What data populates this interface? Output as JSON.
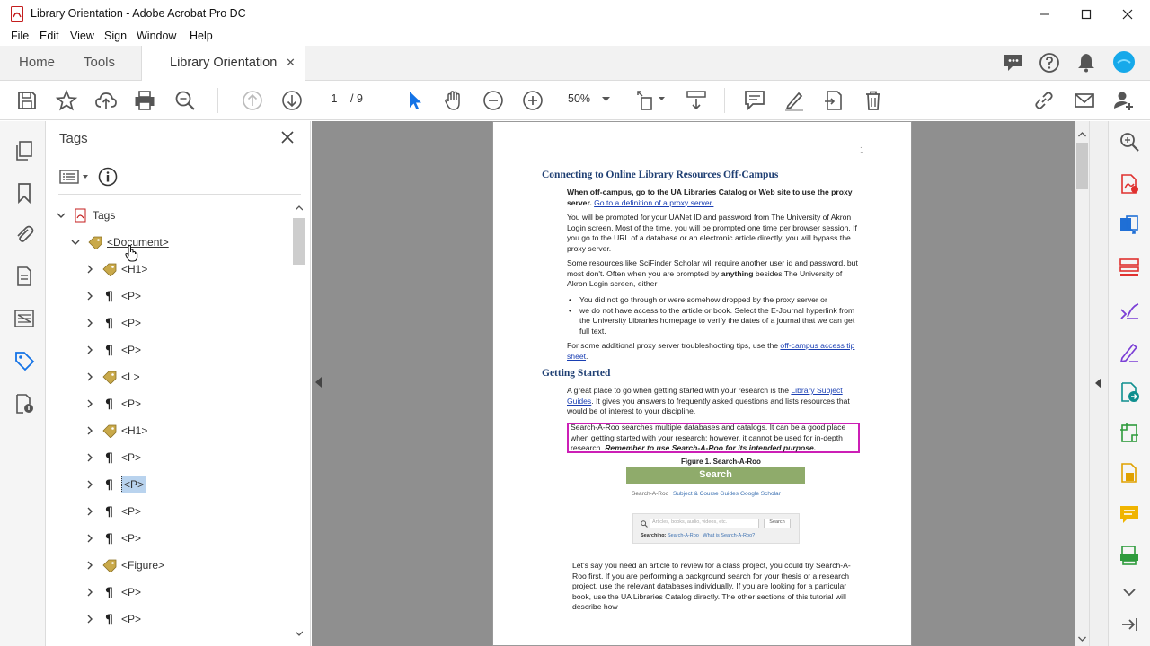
{
  "window": {
    "title": "Library Orientation - Adobe Acrobat Pro DC",
    "app_icon": "acrobat-icon",
    "controls": [
      "minimize-icon",
      "maximize-icon",
      "close-icon"
    ]
  },
  "menu": [
    "File",
    "Edit",
    "View",
    "Sign",
    "Window",
    "Help"
  ],
  "tabs": {
    "home": "Home",
    "tools": "Tools",
    "document": "Library Orientation",
    "close_glyph": "✕"
  },
  "toolbar": {
    "current_page": "1",
    "total_pages": "/ 9",
    "zoom": "50%"
  },
  "tags_panel": {
    "title": "Tags",
    "tree": [
      {
        "label": "Tags",
        "level": 0,
        "icon": "pdf-icon",
        "expanded": true
      },
      {
        "label": "<Document>",
        "level": 1,
        "icon": "tag-icon",
        "expanded": true
      },
      {
        "label": "<H1>",
        "level": 2,
        "icon": "tag-icon"
      },
      {
        "label": "<P>",
        "level": 2,
        "icon": "paragraph-icon"
      },
      {
        "label": "<P>",
        "level": 2,
        "icon": "paragraph-icon"
      },
      {
        "label": "<P>",
        "level": 2,
        "icon": "paragraph-icon"
      },
      {
        "label": "<L>",
        "level": 2,
        "icon": "tag-icon"
      },
      {
        "label": "<P>",
        "level": 2,
        "icon": "paragraph-icon"
      },
      {
        "label": "<H1>",
        "level": 2,
        "icon": "tag-icon"
      },
      {
        "label": "<P>",
        "level": 2,
        "icon": "paragraph-icon"
      },
      {
        "label": "<P>",
        "level": 2,
        "icon": "paragraph-icon",
        "selected": true
      },
      {
        "label": "<P>",
        "level": 2,
        "icon": "paragraph-icon"
      },
      {
        "label": "<P>",
        "level": 2,
        "icon": "paragraph-icon"
      },
      {
        "label": "<Figure>",
        "level": 2,
        "icon": "tag-icon"
      },
      {
        "label": "<P>",
        "level": 2,
        "icon": "paragraph-icon"
      },
      {
        "label": "<P>",
        "level": 2,
        "icon": "paragraph-icon"
      }
    ]
  },
  "document": {
    "page_number": "1",
    "heading1": "Connecting to Online Library Resources Off-Campus",
    "p1_bold": "When off-campus, go to the UA Libraries Catalog or Web site to use the proxy server.",
    "p1_link": "Go to a definition of a proxy server.",
    "p2": "You will be prompted for your UANet ID and password from The University of Akron Login screen. Most of the time, you will be prompted one time per browser session. If you go to the URL of a database or an electronic article directly, you will bypass the proxy server.",
    "p3a": "Some resources like SciFinder Scholar will require another user id and password, but most don't. Often when you are prompted by",
    "p3_bold": "anything",
    "p3b": "besides The University of Akron Login screen, either",
    "bullet1": "You did not go through or were somehow dropped by the proxy server or",
    "bullet2": "we do not have access to the article or book. Select the E-Journal hyperlink from the University Libraries homepage to verify the dates of a journal that we can get full text.",
    "p4a": "For some additional proxy server troubleshooting tips, use the",
    "p4_link": "off-campus access tip sheet",
    "heading2": "Getting Started",
    "p5a": "A great place to go when getting started with your research is the",
    "p5_link": "Library Subject Guides",
    "p5b": ". It gives you answers to frequently asked questions and lists resources that would be of interest to your discipline.",
    "p6": "Search-A-Roo searches multiple databases and catalogs. It can be a good place when getting started with your research; however, it cannot be used for in-depth research.",
    "p6_bold": "Remember to use Search-A-Roo for its intended purpose.",
    "figure_caption": "Figure 1. Search-A-Roo",
    "figure": {
      "header": "Search",
      "tab1": "Search-A-Roo",
      "tab2": "Subject & Course Guides",
      "tab3": "Google Scholar",
      "placeholder": "Articles, books, audio, videos, etc.",
      "button": "Search",
      "searching_label": "Searching:",
      "searching_link1": "Search-A-Roo",
      "searching_link2": "What is Search-A-Roo?"
    },
    "p7": "Let's say you need an article to review for a class project, you could try Search-A-Roo first. If you are performing a background search for your thesis or a research project, use the relevant databases individually. If you are looking for a particular book, use the UA Libraries Catalog directly. The other sections of this tutorial will describe how"
  },
  "colors": {
    "accent_blue": "#1473e6",
    "highlight_magenta": "#cc1fb6",
    "heading_blue": "#1f3f73",
    "figure_green": "#8fab6b"
  }
}
